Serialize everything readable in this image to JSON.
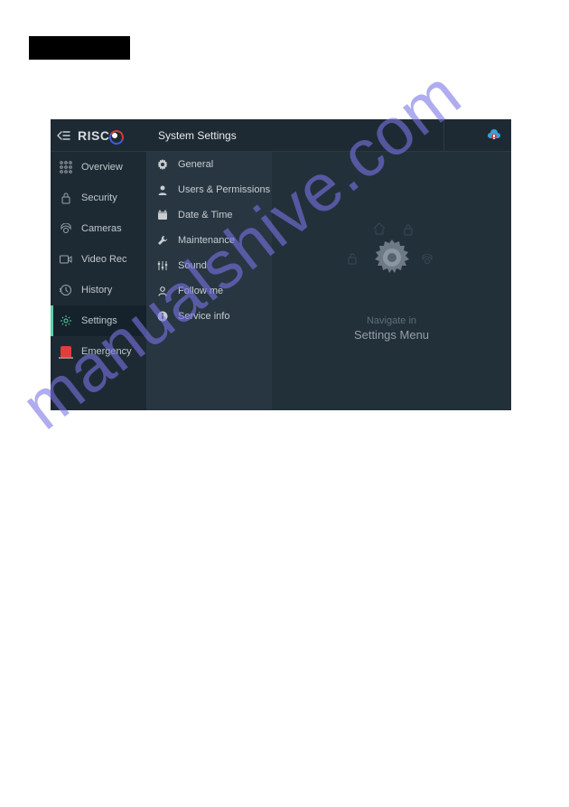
{
  "brand": "RISC",
  "header": {
    "title": "System Settings"
  },
  "sidebar": {
    "items": [
      {
        "label": "Overview"
      },
      {
        "label": "Security"
      },
      {
        "label": "Cameras"
      },
      {
        "label": "Video Rec"
      },
      {
        "label": "History"
      },
      {
        "label": "Settings"
      },
      {
        "label": "Emergency"
      }
    ]
  },
  "settings_menu": {
    "items": [
      {
        "label": "General"
      },
      {
        "label": "Users & Permissions"
      },
      {
        "label": "Date & Time"
      },
      {
        "label": "Maintenance"
      },
      {
        "label": "Sound"
      },
      {
        "label": "Follow me"
      },
      {
        "label": "Service info"
      }
    ]
  },
  "content": {
    "hint_line1": "Navigate in",
    "hint_line2": "Settings Menu"
  },
  "watermark": "manualshive.com"
}
